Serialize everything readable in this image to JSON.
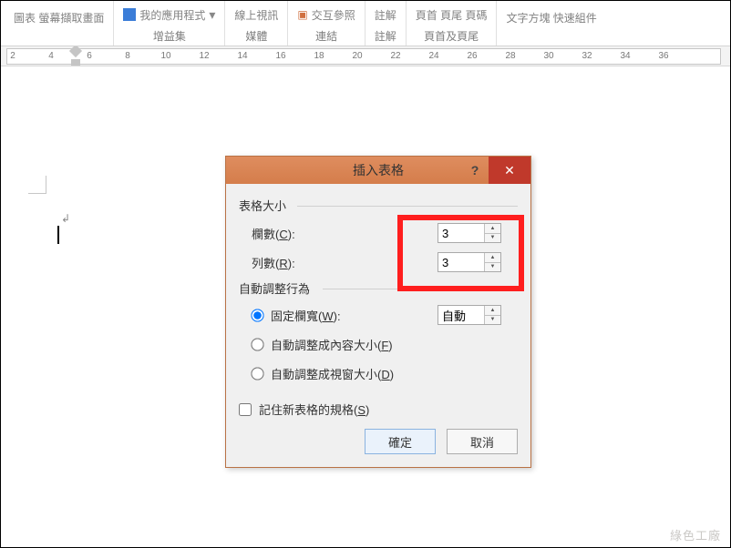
{
  "ribbon": {
    "group0_top": "圖表  螢幕擷取畫面",
    "group1_top": "我的應用程式",
    "group1_label": "增益集",
    "group2_top": "線上視訊",
    "group2_label": "媒體",
    "group3_top": "交互參照",
    "group3_label": "連結",
    "group4_top": "註解",
    "group4_label": "註解",
    "group5_top": "頁首   頁尾   頁碼",
    "group5_label": "頁首及頁尾",
    "group6_top": "文字方塊 快速組件"
  },
  "ruler_ticks": [
    2,
    4,
    6,
    8,
    10,
    12,
    14,
    16,
    18,
    20,
    22,
    24,
    26,
    28,
    30,
    32,
    34,
    36
  ],
  "dialog": {
    "title": "插入表格",
    "help": "?",
    "close": "✕",
    "section_size": "表格大小",
    "columns_label": "欄數(",
    "columns_hotkey": "C",
    "columns_suffix": "):",
    "columns_value": "3",
    "rows_label": "列數(",
    "rows_hotkey": "R",
    "rows_suffix": "):",
    "rows_value": "3",
    "section_autofit": "自動調整行為",
    "radio_fixed_label": "固定欄寬(",
    "radio_fixed_hotkey": "W",
    "radio_fixed_suffix": "):",
    "fixed_value": "自動",
    "radio_content_label": "自動調整成內容大小(",
    "radio_content_hotkey": "F",
    "radio_content_suffix": ")",
    "radio_window_label": "自動調整成視窗大小(",
    "radio_window_hotkey": "D",
    "radio_window_suffix": ")",
    "remember_label": "記住新表格的規格(",
    "remember_hotkey": "S",
    "remember_suffix": ")",
    "ok": "確定",
    "cancel": "取消"
  },
  "watermark": "綠色工廠"
}
